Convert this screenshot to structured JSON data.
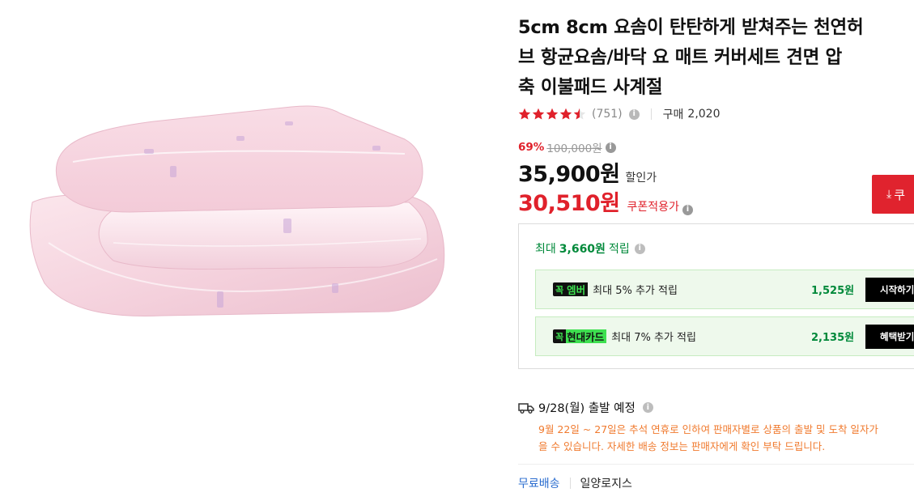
{
  "product": {
    "title_lines": [
      "5cm 8cm 요솜이 탄탄하게 받쳐주는 천연허",
      "브 항균요솜/바닥 요 매트 커버세트 견면 압",
      "축 이불패드 사계절"
    ],
    "image_icon": "folded-pink-quilt-image"
  },
  "rating": {
    "stars_value": 4.5,
    "stars_max": 5,
    "review_count": "(751)",
    "purchase_label": "구매",
    "purchase_count": "2,020",
    "star_color": "#e0212b"
  },
  "price": {
    "discount_rate": "69%",
    "original_price": "100,000원",
    "sale_price": "35,900원",
    "sale_label": "할인가",
    "coupon_price": "30,510원",
    "coupon_label": "쿠폰적용가",
    "coupon_button_label": "쿠",
    "accent_color": "#e0212b"
  },
  "reward": {
    "prefix": "최대",
    "amount": "3,660원",
    "suffix": "적립",
    "promos": [
      {
        "badge": "꼭",
        "brand": "엠버",
        "desc": "최대 5% 추가 적립",
        "amount": "1,525원",
        "button": "시작하기"
      },
      {
        "badge": "꼭",
        "brand": "현대카드",
        "desc": "최대 7% 추가 적립",
        "amount": "2,135원",
        "button": "혜택받기"
      }
    ],
    "green_color": "#00893a"
  },
  "shipping": {
    "date_label": "9/28(월) 출발 예정",
    "notice_lines": [
      "9월 22일 ~ 27일은 추석 연휴로 인하여 판매자별로 상품의 출발 및 도착 일자가",
      "을 수 있습니다. 자세한 배송 정보는 판매자에게 확인 부탁 드립니다."
    ],
    "free_label": "무료배송",
    "carrier": "일양로지스",
    "notice_color": "#f07a2e"
  }
}
